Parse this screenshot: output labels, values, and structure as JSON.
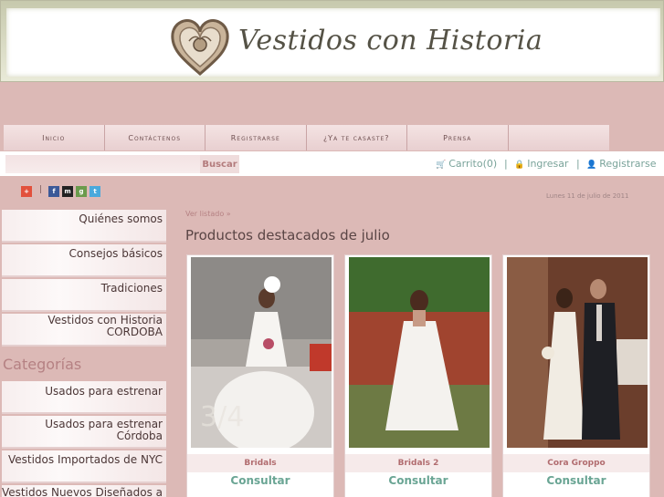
{
  "header": {
    "site_title": "Vestidos con Historia"
  },
  "nav": {
    "items": [
      {
        "label": "Inicio"
      },
      {
        "label": "Contáctenos"
      },
      {
        "label": "Registrarse"
      },
      {
        "label": "¿Ya te casaste?"
      },
      {
        "label": "Prensa"
      },
      {
        "label": ""
      }
    ]
  },
  "toolbar": {
    "search_value": "",
    "search_button": "Buscar",
    "cart_label": "Carrito(0)",
    "login_label": "Ingresar",
    "register_label": "Registrarse",
    "separator": "|"
  },
  "social": {
    "separator": "|",
    "icons": [
      "plus-icon",
      "facebook-icon",
      "myspace-icon",
      "delicious-icon",
      "twitter-icon"
    ]
  },
  "date_text": "Lunes 11 de julio de 2011",
  "sidebar": {
    "items": [
      {
        "label": "Quiénes somos"
      },
      {
        "label": "Consejos básicos"
      },
      {
        "label": "Tradiciones"
      },
      {
        "label": "Vestidos con Historia CORDOBA"
      }
    ],
    "categories_title": "Categorías",
    "categories": [
      {
        "label": "Usados para estrenar"
      },
      {
        "label": "Usados para estrenar Córdoba"
      },
      {
        "label": "Vestidos Importados de NYC"
      },
      {
        "label": "Vestidos Nuevos Diseñados a"
      }
    ]
  },
  "main": {
    "breadcrumb": "Ver listado »",
    "title": "Productos destacados de julio",
    "products": [
      {
        "name": "Bridals",
        "cta": "Consultar",
        "watermark": "3/4"
      },
      {
        "name": "Bridals 2",
        "cta": "Consultar"
      },
      {
        "name": "Cora Groppo",
        "cta": "Consultar"
      }
    ]
  }
}
